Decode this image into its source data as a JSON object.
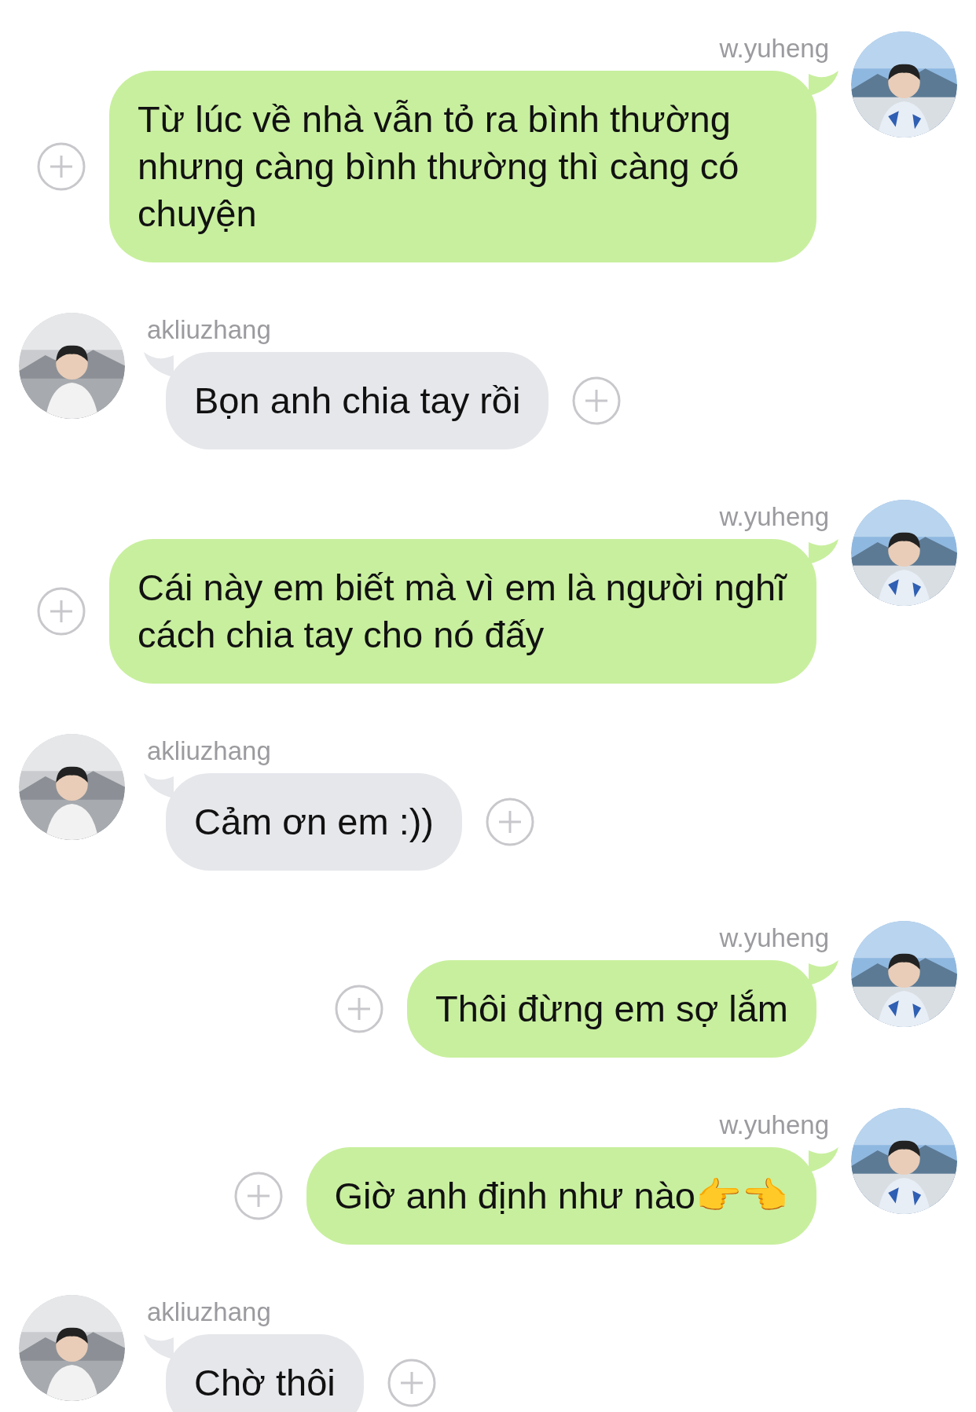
{
  "messages": [
    {
      "kind": "sent",
      "sender": "w.yuheng",
      "text": "Từ lúc về nhà vẫn tỏ ra bình thường nhưng càng bình thường thì càng có chuyện"
    },
    {
      "kind": "received",
      "sender": "akliuzhang",
      "text": "Bọn anh chia tay rồi"
    },
    {
      "kind": "sent",
      "sender": "w.yuheng",
      "text": "Cái này em biết mà vì em là người nghĩ cách chia tay cho nó đấy"
    },
    {
      "kind": "received",
      "sender": "akliuzhang",
      "text": "Cảm ơn em :))"
    },
    {
      "kind": "sent",
      "sender": "w.yuheng",
      "text": "Thôi đừng em sợ lắm"
    },
    {
      "kind": "sent",
      "sender": "w.yuheng",
      "text": "Giờ anh định như nào👉👈"
    },
    {
      "kind": "received",
      "sender": "akliuzhang",
      "text": "Chờ thôi"
    }
  ]
}
